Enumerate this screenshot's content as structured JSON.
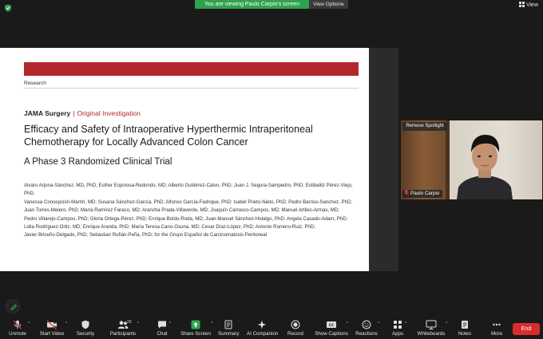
{
  "top_bar": {
    "banner_text": "You are viewing Paulo Carpio's screen",
    "view_options_label": "View Options",
    "view_label": "View"
  },
  "shared_screen": {
    "section_label": "Research",
    "journal_name": "JAMA Surgery",
    "separator": "|",
    "article_type": "Original Investigation",
    "title_line1": "Efficacy and Safety of Intraoperative Hyperthermic Intraperitoneal",
    "title_line2": "Chemotherapy for Locally Advanced Colon Cancer",
    "subtitle": "A Phase 3 Randomized Clinical Trial",
    "author_lines": [
      "Alvaro Arjona-Sánchez, MD, PhD; Esther Espinosa-Redondo, MD; Alberto Gutiérrez-Calvo, PhD; Juan J. Segura-Sampedro, PhD; Estibalitz Pérez-Viejo, PhD;",
      "Vanessa Concepción-Martín, MD; Susana Sánchez-García, PhD; Alfonso García-Fadrique, PhD; Isabel Prieto-Nieto, PhD; Pedro Barrios-Sanchez, PhD;",
      "Juan Torres-Melero, PhD; María Ramírez Faraco, MD; Arancha Prada-Villaverde, MD; Joaquín Carrasco-Campos, MD; Manuel Artiles-Armas, MD;",
      "Pedro Villarejo-Campos, PhD; Gloria Ortega-Pérez, PhD; Enrique Boldo-Roda, MD; Juan-Manuel Sánchez-Hidalgo, PhD; Angela Casado-Adam, PhD;",
      "Lidia Rodríguez-Ortiz, MD; Enrique Aranda, PhD; María Teresa Cano-Osuna, MD; Cesar Díaz-López, PhD; Antonio Romero-Ruiz, PhD;",
      "Javier Briceño-Delgado, PhD; Sebastian Rufián-Peña, PhD; for the Grupo Español de Carcinomatosis Peritoneal"
    ]
  },
  "participant_tile": {
    "remove_spotlight_label": "Remove Spotlight",
    "name": "Paulo Carpio"
  },
  "toolbar": {
    "unmute": "Unmute",
    "start_video": "Start Video",
    "security": "Security",
    "participants": "Participants",
    "participants_count": "23",
    "chat": "Chat",
    "share_screen": "Share Screen",
    "summary": "Summary",
    "ai_companion": "AI Companion",
    "record": "Record",
    "show_captions": "Show Captions",
    "reactions": "Reactions",
    "apps": "Apps",
    "whiteboards": "Whiteboards",
    "notes": "Notes",
    "more": "More",
    "end": "End"
  },
  "colors": {
    "banner_green": "#30a14e",
    "share_green": "#2fa84f",
    "end_red": "#d92d2d",
    "mute_red": "#e0433c",
    "journal_red": "#b3282d"
  },
  "icons": [
    "shield-icon",
    "grid-icon",
    "microphone-muted-icon",
    "video-off-icon",
    "security-shield-icon",
    "participants-icon",
    "chat-icon",
    "share-screen-icon",
    "summary-icon",
    "ai-companion-icon",
    "record-icon",
    "captions-icon",
    "reactions-icon",
    "apps-icon",
    "whiteboards-icon",
    "notes-icon",
    "more-icon",
    "reaction-bubble-icon"
  ]
}
